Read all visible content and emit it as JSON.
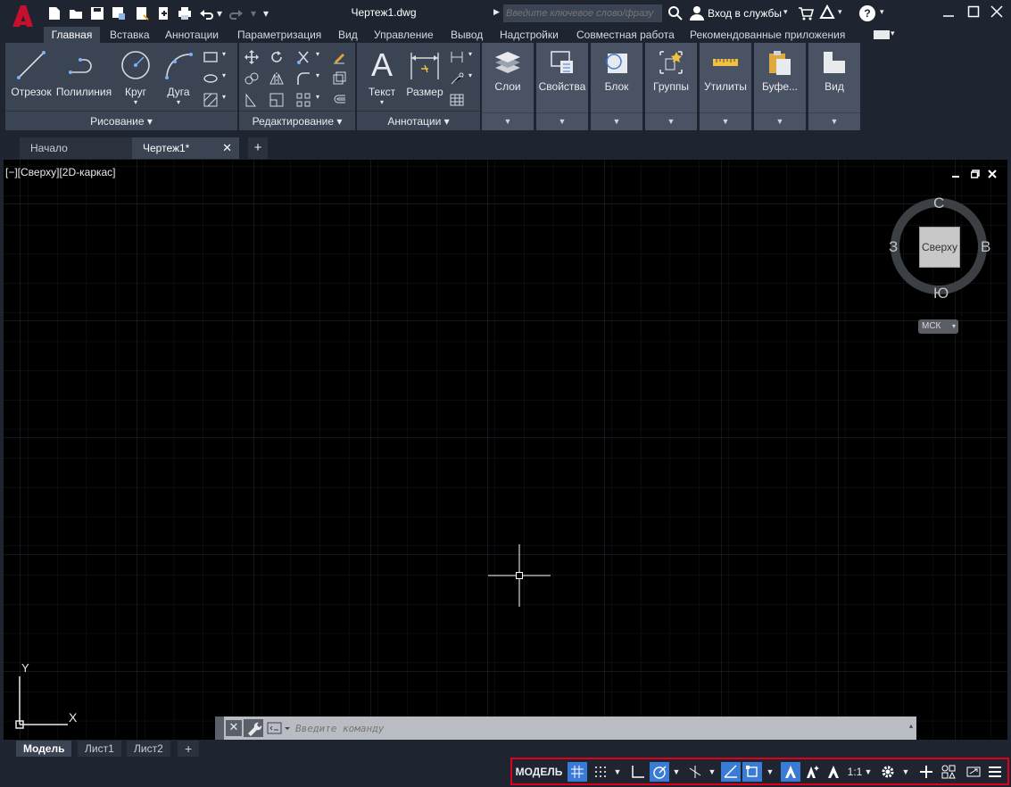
{
  "titlebar": {
    "filename": "Чертеж1.dwg",
    "search_placeholder": "Введите ключевое слово/фразу",
    "signin_label": "Вход в службы",
    "help_label": "?"
  },
  "ribbon_tabs": [
    "Главная",
    "Вставка",
    "Аннотации",
    "Параметризация",
    "Вид",
    "Управление",
    "Вывод",
    "Надстройки",
    "Совместная работа",
    "Рекомендованные приложения"
  ],
  "ribbon": {
    "draw": {
      "title": "Рисование",
      "line": "Отрезок",
      "polyline": "Полилиния",
      "circle": "Круг",
      "arc": "Дуга"
    },
    "modify": {
      "title": "Редактирование"
    },
    "annotation": {
      "title": "Аннотации",
      "text": "Текст",
      "dimension": "Размер"
    },
    "layers": "Слои",
    "properties": "Свойства",
    "block": "Блок",
    "groups": "Группы",
    "utilities": "Утилиты",
    "clipboard": "Буфе...",
    "view": "Вид"
  },
  "doc_tabs": {
    "start": "Начало",
    "drawing": "Чертеж1*",
    "add": "+"
  },
  "viewport": {
    "label": "[−][Сверху][2D-каркас]",
    "viewcube": {
      "north": "С",
      "south": "Ю",
      "west": "З",
      "east": "В",
      "face": "Сверху",
      "wcs": "МСК"
    },
    "ucs": {
      "x": "X",
      "y": "Y"
    }
  },
  "command_line": {
    "placeholder": "Введите команду"
  },
  "layout_tabs": [
    "Модель",
    "Лист1",
    "Лист2"
  ],
  "status": {
    "model": "МОДЕЛЬ",
    "scale": "1:1"
  },
  "colors": {
    "accent": "#3a7bd5",
    "highlight_border": "#e0001b",
    "brand": "#c8102e"
  }
}
